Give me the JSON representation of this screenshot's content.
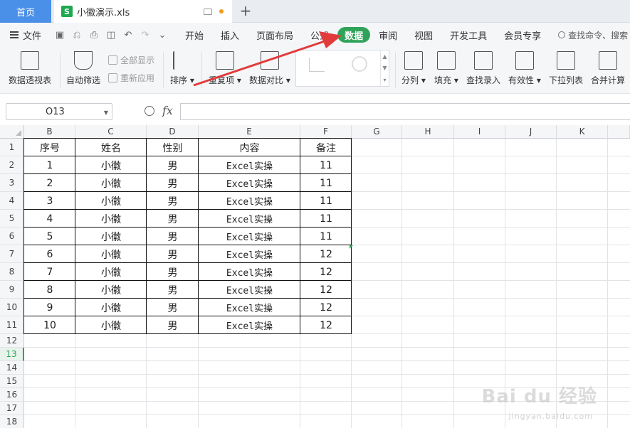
{
  "titlebar": {
    "home_tab": "首页",
    "file_tab": "小徽演示.xls",
    "file_icon_letter": "S",
    "new_tab_label": "+"
  },
  "menubar": {
    "file_label": "文件",
    "items": [
      "开始",
      "插入",
      "页面布局",
      "公式",
      "数据",
      "审阅",
      "视图",
      "开发工具",
      "会员专享"
    ],
    "active_index": 4,
    "search_placeholder": "查找命令、搜索"
  },
  "ribbon": {
    "pivot": "数据透视表",
    "autofilter": "自动筛选",
    "show_all": "全部显示",
    "reapply": "重新应用",
    "sort": "排序",
    "duplicates": "重复项",
    "compare": "数据对比",
    "split": "分列",
    "fill": "填充",
    "lookup": "查找录入",
    "validity": "有效性",
    "dropdown": "下拉列表",
    "consolidate": "合并计算"
  },
  "formulabar": {
    "name_box": "O13",
    "fx_label": "fx",
    "formula_value": ""
  },
  "sheet": {
    "columns": [
      "B",
      "C",
      "D",
      "E",
      "F",
      "G",
      "H",
      "I",
      "J",
      "K"
    ],
    "rows": [
      "1",
      "2",
      "3",
      "4",
      "5",
      "6",
      "7",
      "8",
      "9",
      "10",
      "11",
      "12",
      "13",
      "14",
      "15",
      "16",
      "17",
      "18"
    ],
    "selected_row": "13",
    "headers": [
      "序号",
      "姓名",
      "性别",
      "内容",
      "备注"
    ],
    "data": [
      [
        "1",
        "小徽",
        "男",
        "Excel实操",
        "11"
      ],
      [
        "2",
        "小徽",
        "男",
        "Excel实操",
        "11"
      ],
      [
        "3",
        "小徽",
        "男",
        "Excel实操",
        "11"
      ],
      [
        "4",
        "小徽",
        "男",
        "Excel实操",
        "11"
      ],
      [
        "5",
        "小徽",
        "男",
        "Excel实操",
        "11"
      ],
      [
        "6",
        "小徽",
        "男",
        "Excel实操",
        "12"
      ],
      [
        "7",
        "小徽",
        "男",
        "Excel实操",
        "12"
      ],
      [
        "8",
        "小徽",
        "男",
        "Excel实操",
        "12"
      ],
      [
        "9",
        "小徽",
        "男",
        "Excel实操",
        "12"
      ],
      [
        "10",
        "小徽",
        "男",
        "Excel实操",
        "12"
      ]
    ]
  },
  "watermark": {
    "brand": "Bai du 经验",
    "url": "jingyan.baidu.com"
  },
  "colors": {
    "accent_green": "#2fa35a",
    "home_tab_blue": "#4a8fe8",
    "annotation_red": "#e23b3b"
  }
}
